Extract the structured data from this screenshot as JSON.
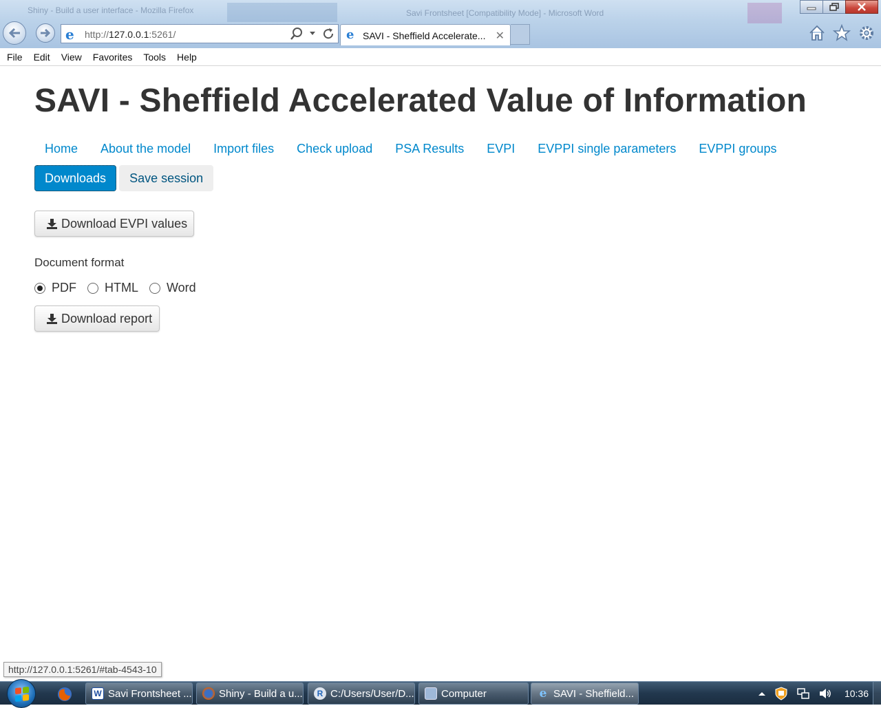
{
  "browser": {
    "background_window_title": "Shiny - Build a user interface - Mozilla Firefox",
    "background_word_title": "Savi Frontsheet [Compatibility Mode] - Microsoft Word",
    "address": {
      "prefix": "http://",
      "host": "127.0.0.1",
      "suffix": ":5261/"
    },
    "tab_title": "SAVI - Sheffield Accelerate...",
    "tab_close": "✕",
    "menu": [
      "File",
      "Edit",
      "View",
      "Favorites",
      "Tools",
      "Help"
    ]
  },
  "page": {
    "title": "SAVI - Sheffield Accelerated Value of Information",
    "nav_tabs": [
      "Home",
      "About the model",
      "Import files",
      "Check upload",
      "PSA Results",
      "EVPI",
      "EVPPI single parameters",
      "EVPPI groups",
      "Downloads",
      "Save session"
    ],
    "active_tab": "Downloads",
    "download_evpi_label": "Download EVPI values",
    "document_format_label": "Document format",
    "format_options": [
      "PDF",
      "HTML",
      "Word"
    ],
    "selected_format": "PDF",
    "download_report_label": "Download report"
  },
  "status_url": "http://127.0.0.1:5261/#tab-4543-10",
  "taskbar": {
    "tasks": [
      {
        "label": "Savi Frontsheet ...",
        "icon": "word-icon",
        "icon_text": "W"
      },
      {
        "label": "Shiny - Build a u...",
        "icon": "firefox-icon",
        "icon_text": ""
      },
      {
        "label": "C:/Users/User/D...",
        "icon": "r-icon",
        "icon_text": "R"
      },
      {
        "label": "Computer",
        "icon": "computer-icon",
        "icon_text": ""
      },
      {
        "label": "SAVI - Sheffield...",
        "icon": "ie-icon",
        "icon_text": "e"
      }
    ],
    "clock": "10:36"
  },
  "colors": {
    "link": "#0088cc",
    "active_tab_bg": "#0088cc",
    "title_text": "#333333"
  }
}
